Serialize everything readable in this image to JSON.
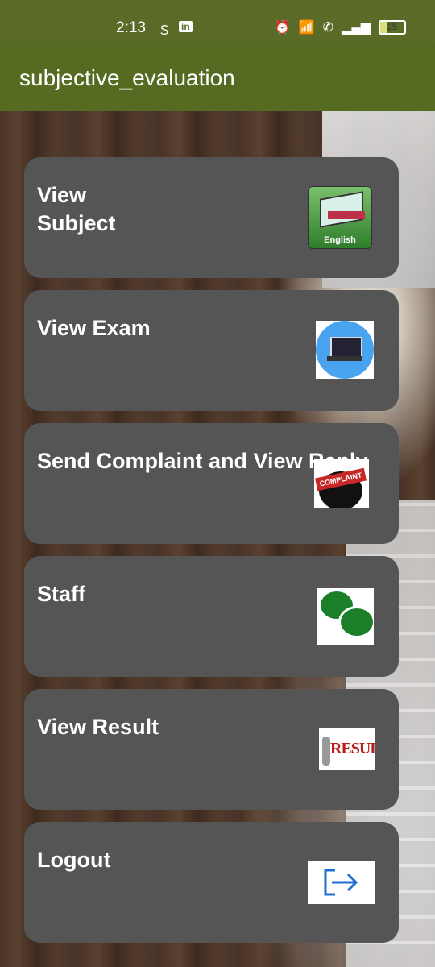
{
  "status_bar": {
    "time": "2:13",
    "battery": "25",
    "icons": [
      "sim-s-icon",
      "linkedin-icon",
      "alarm-icon",
      "wifi-icon",
      "call-icon",
      "signal-icon",
      "battery-icon"
    ]
  },
  "app_bar": {
    "title": "subjective_evaluation"
  },
  "menu": [
    {
      "label": "View\nSubject",
      "icon": "english-book-icon",
      "icon_caption": "English"
    },
    {
      "label": "View Exam",
      "icon": "laptop-exam-icon"
    },
    {
      "label": "Send Complaint and View Reply",
      "icon": "complaint-stamp-icon",
      "icon_caption": "COMPLAINT"
    },
    {
      "label": " Staff",
      "icon": "chat-bubbles-icon"
    },
    {
      "label": "View Result",
      "icon": "results-icon",
      "icon_caption": "RESULTS"
    },
    {
      "label": "Logout",
      "icon": "logout-icon"
    }
  ],
  "colors": {
    "status_bar": "#5a6b28",
    "app_bar": "#556b22",
    "card": "#555555",
    "text": "#ffffff"
  }
}
